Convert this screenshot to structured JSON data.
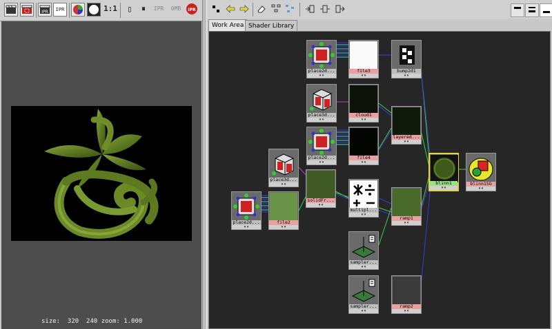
{
  "render_view": {
    "toolbar": {
      "buttons": [
        {
          "name": "render-clapper-icon",
          "glyph": "🎬"
        },
        {
          "name": "render-region-icon",
          "glyph": "🎬"
        },
        {
          "name": "ipr-clapper-icon",
          "glyph": "🎬"
        },
        {
          "name": "ipr-button",
          "glyph": "IPR"
        },
        {
          "name": "rgb-channel-icon",
          "glyph": "◉"
        },
        {
          "name": "alpha-channel-icon",
          "glyph": "●"
        }
      ],
      "ratio_label": "1:1",
      "snapshot_label": "▯",
      "pause_label": "⏸",
      "ipr_label_1": "IPR",
      "memory_label": "0MB",
      "ipr_stop_label": "IPR"
    },
    "status": "size:  320  240 zoom: 1.000"
  },
  "hypershade": {
    "toolbar_icons": [
      "arrow-out-icon",
      "arrow-left-icon",
      "arrow-right-icon",
      "eraser-icon",
      "graph-icon",
      "rearrange-icon",
      "input-connections-icon",
      "io-connections-icon",
      "output-connections-icon",
      "layout-top-icon",
      "layout-both-icon",
      "layout-bottom-icon"
    ],
    "tabs": [
      {
        "label": "Work Area",
        "active": true
      },
      {
        "label": "Shader Library",
        "active": false
      }
    ],
    "nodes": {
      "place2d_1": "place2d...",
      "file3": "file3",
      "bump2d1": "bump2d1",
      "place3d_1": "place3d...",
      "cloud1": "cloud1",
      "layered": "layered...",
      "place2d_2": "place2d...",
      "file4": "file4",
      "place3d_2": "place3d...",
      "solidFr": "solidFr...",
      "blinn1": "blinn1",
      "blinn1SG": "blinn1SG",
      "multipl": "multipl...",
      "place2d_3": "place2d...",
      "file2": "file2",
      "ramp1": "ramp1",
      "sampler_1": "sampler...",
      "sampler_2": "sampler...",
      "ramp2": "ramp2"
    },
    "colors": {
      "texture_label": "#e8a0a0",
      "material_label": "#9ee08a",
      "selected_outline": "#e6d23a",
      "wire_green": "#3cd24a",
      "wire_blue": "#3c3cd8",
      "wire_magenta": "#c83cc8"
    }
  }
}
